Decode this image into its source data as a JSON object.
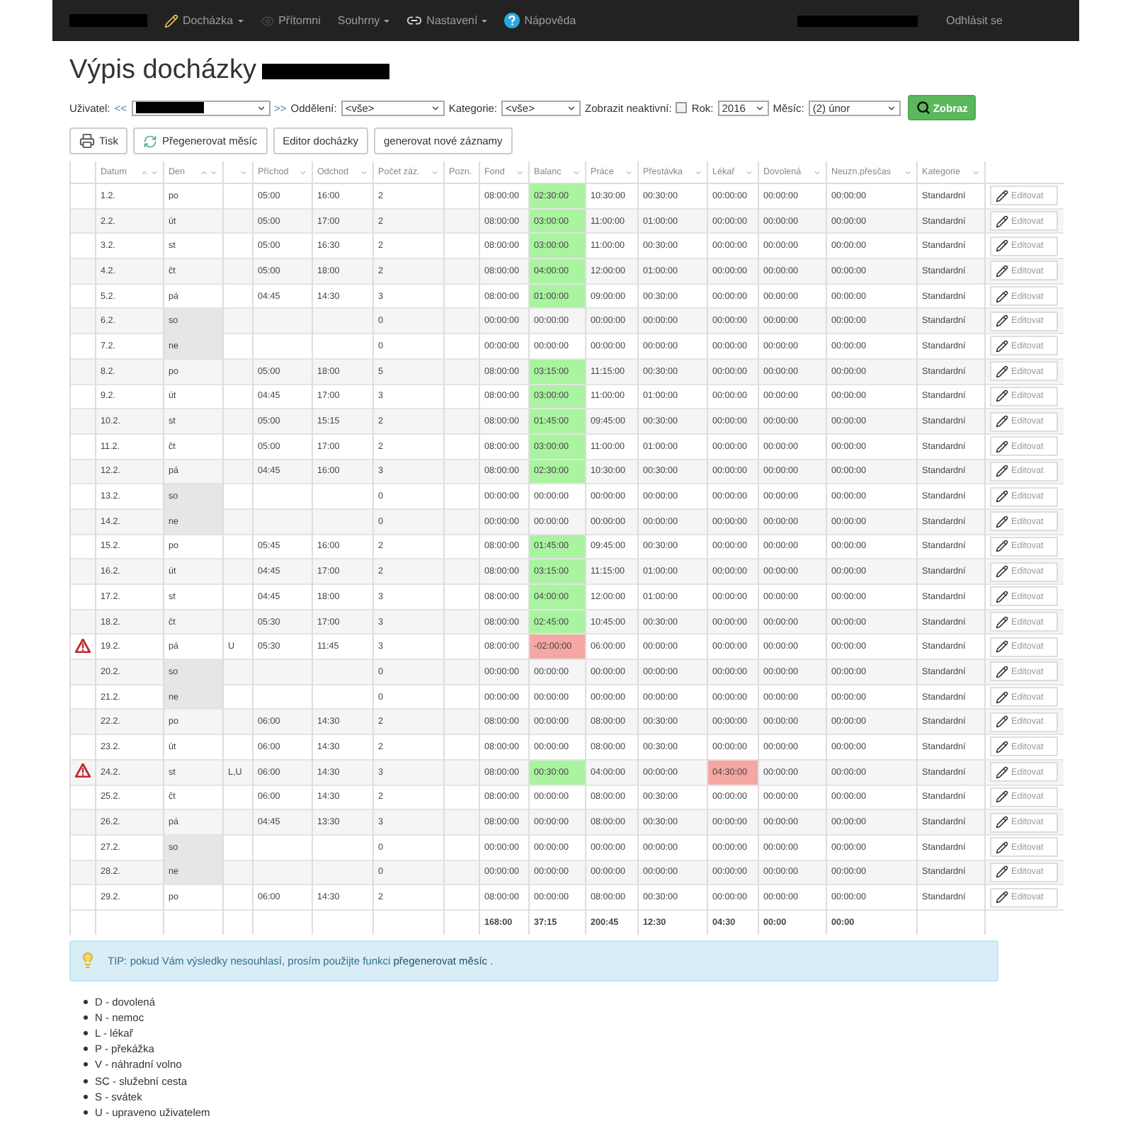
{
  "nav": {
    "items": [
      {
        "label": "Docházka",
        "dropdown": true
      },
      {
        "label": "Přítomni",
        "dropdown": false
      },
      {
        "label": "Souhrny",
        "dropdown": true
      },
      {
        "label": "Nastavení",
        "dropdown": true
      },
      {
        "label": "Nápověda",
        "dropdown": false
      }
    ],
    "logout": "Odhlásit se"
  },
  "title": "Výpis docházky",
  "filters": {
    "user_label": "Uživatel:",
    "prev": "<<",
    "next": ">>",
    "department_label": "Oddělení:",
    "department": "<vše>",
    "category_label": "Kategorie:",
    "category": "<vše>",
    "inactive_label": "Zobrazit neaktivní:",
    "inactive": false,
    "year_label": "Rok:",
    "year": "2016",
    "month_label": "Měsíc:",
    "month": "(2) únor",
    "submit": "Zobraz"
  },
  "actions": [
    {
      "label": "Tisk"
    },
    {
      "label": "Přegenerovat měsíc"
    },
    {
      "label": "Editor docházky"
    },
    {
      "label": "generovat nové záznamy"
    }
  ],
  "table": {
    "columns": [
      {
        "sorted": false,
        "filter": false
      },
      {
        "label": "Datum",
        "sorted": true,
        "filter": true
      },
      {
        "label": "Den",
        "sorted": true,
        "filter": true
      },
      {
        "sorted": false,
        "filter": true
      },
      {
        "label": "Příchod",
        "sorted": false,
        "filter": true
      },
      {
        "label": "Odchod",
        "sorted": false,
        "filter": true
      },
      {
        "label": "Počet záz.",
        "sorted": false,
        "filter": true
      },
      {
        "label": "Pozn.",
        "sorted": false,
        "filter": false
      },
      {
        "label": "Fond",
        "sorted": false,
        "filter": true
      },
      {
        "label": "Balanc",
        "sorted": false,
        "filter": true
      },
      {
        "label": "Práce",
        "sorted": false,
        "filter": true
      },
      {
        "label": "Přestávka",
        "sorted": false,
        "filter": true
      },
      {
        "label": "Lékař",
        "sorted": false,
        "filter": true
      },
      {
        "label": "Dovolená",
        "sorted": false,
        "filter": true
      },
      {
        "label": "Neuzn.přesčas",
        "sorted": false,
        "filter": true
      },
      {
        "label": "Kategorie",
        "sorted": false,
        "filter": true
      },
      {
        "sorted": false,
        "filter": false
      }
    ],
    "rows": [
      {
        "warning": false,
        "date": "1.2.",
        "day": "po",
        "weekend": false,
        "arrival": "05:00",
        "departure": "16:00",
        "records": "2",
        "fond": "08:00:00",
        "balance": "02:30:00",
        "surplus": true,
        "deficit": false,
        "work": "10:30:00",
        "break": "00:30:00",
        "doctor": "00:00:00",
        "doctor_alert": false,
        "vacation": "00:00:00",
        "overtime": "00:00:00",
        "category": "Standardní",
        "edit": "Editovat"
      },
      {
        "warning": false,
        "date": "2.2.",
        "day": "út",
        "weekend": false,
        "arrival": "05:00",
        "departure": "17:00",
        "records": "2",
        "fond": "08:00:00",
        "balance": "03:00:00",
        "surplus": true,
        "deficit": false,
        "work": "11:00:00",
        "break": "01:00:00",
        "doctor": "00:00:00",
        "doctor_alert": false,
        "vacation": "00:00:00",
        "overtime": "00:00:00",
        "category": "Standardní",
        "edit": "Editovat"
      },
      {
        "warning": false,
        "date": "3.2.",
        "day": "st",
        "weekend": false,
        "arrival": "05:00",
        "departure": "16:30",
        "records": "2",
        "fond": "08:00:00",
        "balance": "03:00:00",
        "surplus": true,
        "deficit": false,
        "work": "11:00:00",
        "break": "00:30:00",
        "doctor": "00:00:00",
        "doctor_alert": false,
        "vacation": "00:00:00",
        "overtime": "00:00:00",
        "category": "Standardní",
        "edit": "Editovat"
      },
      {
        "warning": false,
        "date": "4.2.",
        "day": "čt",
        "weekend": false,
        "arrival": "05:00",
        "departure": "18:00",
        "records": "2",
        "fond": "08:00:00",
        "balance": "04:00:00",
        "surplus": true,
        "deficit": false,
        "work": "12:00:00",
        "break": "01:00:00",
        "doctor": "00:00:00",
        "doctor_alert": false,
        "vacation": "00:00:00",
        "overtime": "00:00:00",
        "category": "Standardní",
        "edit": "Editovat"
      },
      {
        "warning": false,
        "date": "5.2.",
        "day": "pá",
        "weekend": false,
        "arrival": "04:45",
        "departure": "14:30",
        "records": "3",
        "fond": "08:00:00",
        "balance": "01:00:00",
        "surplus": true,
        "deficit": false,
        "work": "09:00:00",
        "break": "00:30:00",
        "doctor": "00:00:00",
        "doctor_alert": false,
        "vacation": "00:00:00",
        "overtime": "00:00:00",
        "category": "Standardní",
        "edit": "Editovat"
      },
      {
        "warning": false,
        "date": "6.2.",
        "day": "so",
        "weekend": true,
        "records": "0",
        "fond": "00:00:00",
        "balance": "00:00:00",
        "surplus": false,
        "deficit": false,
        "work": "00:00:00",
        "break": "00:00:00",
        "doctor": "00:00:00",
        "doctor_alert": false,
        "vacation": "00:00:00",
        "overtime": "00:00:00",
        "category": "Standardní",
        "edit": "Editovat"
      },
      {
        "warning": false,
        "date": "7.2.",
        "day": "ne",
        "weekend": true,
        "records": "0",
        "fond": "00:00:00",
        "balance": "00:00:00",
        "surplus": false,
        "deficit": false,
        "work": "00:00:00",
        "break": "00:00:00",
        "doctor": "00:00:00",
        "doctor_alert": false,
        "vacation": "00:00:00",
        "overtime": "00:00:00",
        "category": "Standardní",
        "edit": "Editovat"
      },
      {
        "warning": false,
        "date": "8.2.",
        "day": "po",
        "weekend": false,
        "arrival": "05:00",
        "departure": "18:00",
        "records": "5",
        "fond": "08:00:00",
        "balance": "03:15:00",
        "surplus": true,
        "deficit": false,
        "work": "11:15:00",
        "break": "00:30:00",
        "doctor": "00:00:00",
        "doctor_alert": false,
        "vacation": "00:00:00",
        "overtime": "00:00:00",
        "category": "Standardní",
        "edit": "Editovat"
      },
      {
        "warning": false,
        "date": "9.2.",
        "day": "út",
        "weekend": false,
        "arrival": "04:45",
        "departure": "17:00",
        "records": "3",
        "fond": "08:00:00",
        "balance": "03:00:00",
        "surplus": true,
        "deficit": false,
        "work": "11:00:00",
        "break": "01:00:00",
        "doctor": "00:00:00",
        "doctor_alert": false,
        "vacation": "00:00:00",
        "overtime": "00:00:00",
        "category": "Standardní",
        "edit": "Editovat"
      },
      {
        "warning": false,
        "date": "10.2.",
        "day": "st",
        "weekend": false,
        "arrival": "05:00",
        "departure": "15:15",
        "records": "2",
        "fond": "08:00:00",
        "balance": "01:45:00",
        "surplus": true,
        "deficit": false,
        "work": "09:45:00",
        "break": "00:30:00",
        "doctor": "00:00:00",
        "doctor_alert": false,
        "vacation": "00:00:00",
        "overtime": "00:00:00",
        "category": "Standardní",
        "edit": "Editovat"
      },
      {
        "warning": false,
        "date": "11.2.",
        "day": "čt",
        "weekend": false,
        "arrival": "05:00",
        "departure": "17:00",
        "records": "2",
        "fond": "08:00:00",
        "balance": "03:00:00",
        "surplus": true,
        "deficit": false,
        "work": "11:00:00",
        "break": "01:00:00",
        "doctor": "00:00:00",
        "doctor_alert": false,
        "vacation": "00:00:00",
        "overtime": "00:00:00",
        "category": "Standardní",
        "edit": "Editovat"
      },
      {
        "warning": false,
        "date": "12.2.",
        "day": "pá",
        "weekend": false,
        "arrival": "04:45",
        "departure": "16:00",
        "records": "3",
        "fond": "08:00:00",
        "balance": "02:30:00",
        "surplus": true,
        "deficit": false,
        "work": "10:30:00",
        "break": "00:30:00",
        "doctor": "00:00:00",
        "doctor_alert": false,
        "vacation": "00:00:00",
        "overtime": "00:00:00",
        "category": "Standardní",
        "edit": "Editovat"
      },
      {
        "warning": false,
        "date": "13.2.",
        "day": "so",
        "weekend": true,
        "records": "0",
        "fond": "00:00:00",
        "balance": "00:00:00",
        "surplus": false,
        "deficit": false,
        "work": "00:00:00",
        "break": "00:00:00",
        "doctor": "00:00:00",
        "doctor_alert": false,
        "vacation": "00:00:00",
        "overtime": "00:00:00",
        "category": "Standardní",
        "edit": "Editovat"
      },
      {
        "warning": false,
        "date": "14.2.",
        "day": "ne",
        "weekend": true,
        "records": "0",
        "fond": "00:00:00",
        "balance": "00:00:00",
        "surplus": false,
        "deficit": false,
        "work": "00:00:00",
        "break": "00:00:00",
        "doctor": "00:00:00",
        "doctor_alert": false,
        "vacation": "00:00:00",
        "overtime": "00:00:00",
        "category": "Standardní",
        "edit": "Editovat"
      },
      {
        "warning": false,
        "date": "15.2.",
        "day": "po",
        "weekend": false,
        "arrival": "05:45",
        "departure": "16:00",
        "records": "2",
        "fond": "08:00:00",
        "balance": "01:45:00",
        "surplus": true,
        "deficit": false,
        "work": "09:45:00",
        "break": "00:30:00",
        "doctor": "00:00:00",
        "doctor_alert": false,
        "vacation": "00:00:00",
        "overtime": "00:00:00",
        "category": "Standardní",
        "edit": "Editovat"
      },
      {
        "warning": false,
        "date": "16.2.",
        "day": "út",
        "weekend": false,
        "arrival": "04:45",
        "departure": "17:00",
        "records": "2",
        "fond": "08:00:00",
        "balance": "03:15:00",
        "surplus": true,
        "deficit": false,
        "work": "11:15:00",
        "break": "01:00:00",
        "doctor": "00:00:00",
        "doctor_alert": false,
        "vacation": "00:00:00",
        "overtime": "00:00:00",
        "category": "Standardní",
        "edit": "Editovat"
      },
      {
        "warning": false,
        "date": "17.2.",
        "day": "st",
        "weekend": false,
        "arrival": "04:45",
        "departure": "18:00",
        "records": "3",
        "fond": "08:00:00",
        "balance": "04:00:00",
        "surplus": true,
        "deficit": false,
        "work": "12:00:00",
        "break": "01:00:00",
        "doctor": "00:00:00",
        "doctor_alert": false,
        "vacation": "00:00:00",
        "overtime": "00:00:00",
        "category": "Standardní",
        "edit": "Editovat"
      },
      {
        "warning": false,
        "date": "18.2.",
        "day": "čt",
        "weekend": false,
        "arrival": "05:30",
        "departure": "17:00",
        "records": "3",
        "fond": "08:00:00",
        "balance": "02:45:00",
        "surplus": true,
        "deficit": false,
        "work": "10:45:00",
        "break": "00:30:00",
        "doctor": "00:00:00",
        "doctor_alert": false,
        "vacation": "00:00:00",
        "overtime": "00:00:00",
        "category": "Standardní",
        "edit": "Editovat"
      },
      {
        "warning": true,
        "date": "19.2.",
        "day": "pá",
        "weekend": false,
        "code": "U",
        "arrival": "05:30",
        "departure": "11:45",
        "records": "3",
        "fond": "08:00:00",
        "balance": "-02:00:00",
        "surplus": false,
        "deficit": true,
        "work": "06:00:00",
        "break": "00:00:00",
        "doctor": "00:00:00",
        "doctor_alert": false,
        "vacation": "00:00:00",
        "overtime": "00:00:00",
        "category": "Standardní",
        "edit": "Editovat"
      },
      {
        "warning": false,
        "date": "20.2.",
        "day": "so",
        "weekend": true,
        "records": "0",
        "fond": "00:00:00",
        "balance": "00:00:00",
        "surplus": false,
        "deficit": false,
        "work": "00:00:00",
        "break": "00:00:00",
        "doctor": "00:00:00",
        "doctor_alert": false,
        "vacation": "00:00:00",
        "overtime": "00:00:00",
        "category": "Standardní",
        "edit": "Editovat"
      },
      {
        "warning": false,
        "date": "21.2.",
        "day": "ne",
        "weekend": true,
        "records": "0",
        "fond": "00:00:00",
        "balance": "00:00:00",
        "surplus": false,
        "deficit": false,
        "work": "00:00:00",
        "break": "00:00:00",
        "doctor": "00:00:00",
        "doctor_alert": false,
        "vacation": "00:00:00",
        "overtime": "00:00:00",
        "category": "Standardní",
        "edit": "Editovat"
      },
      {
        "warning": false,
        "date": "22.2.",
        "day": "po",
        "weekend": false,
        "arrival": "06:00",
        "departure": "14:30",
        "records": "2",
        "fond": "08:00:00",
        "balance": "00:00:00",
        "surplus": false,
        "deficit": false,
        "work": "08:00:00",
        "break": "00:30:00",
        "doctor": "00:00:00",
        "doctor_alert": false,
        "vacation": "00:00:00",
        "overtime": "00:00:00",
        "category": "Standardní",
        "edit": "Editovat"
      },
      {
        "warning": false,
        "date": "23.2.",
        "day": "út",
        "weekend": false,
        "arrival": "06:00",
        "departure": "14:30",
        "records": "2",
        "fond": "08:00:00",
        "balance": "00:00:00",
        "surplus": false,
        "deficit": false,
        "work": "08:00:00",
        "break": "00:30:00",
        "doctor": "00:00:00",
        "doctor_alert": false,
        "vacation": "00:00:00",
        "overtime": "00:00:00",
        "category": "Standardní",
        "edit": "Editovat"
      },
      {
        "warning": true,
        "date": "24.2.",
        "day": "st",
        "weekend": false,
        "code": "L,U",
        "arrival": "06:00",
        "departure": "14:30",
        "records": "3",
        "fond": "08:00:00",
        "balance": "00:30:00",
        "surplus": true,
        "deficit": false,
        "work": "04:00:00",
        "break": "00:00:00",
        "doctor": "04:30:00",
        "doctor_alert": true,
        "vacation": "00:00:00",
        "overtime": "00:00:00",
        "category": "Standardní",
        "edit": "Editovat"
      },
      {
        "warning": false,
        "date": "25.2.",
        "day": "čt",
        "weekend": false,
        "arrival": "06:00",
        "departure": "14:30",
        "records": "2",
        "fond": "08:00:00",
        "balance": "00:00:00",
        "surplus": false,
        "deficit": false,
        "work": "08:00:00",
        "break": "00:30:00",
        "doctor": "00:00:00",
        "doctor_alert": false,
        "vacation": "00:00:00",
        "overtime": "00:00:00",
        "category": "Standardní",
        "edit": "Editovat"
      },
      {
        "warning": false,
        "date": "26.2.",
        "day": "pá",
        "weekend": false,
        "arrival": "04:45",
        "departure": "13:30",
        "records": "3",
        "fond": "08:00:00",
        "balance": "00:00:00",
        "surplus": false,
        "deficit": false,
        "work": "08:00:00",
        "break": "00:30:00",
        "doctor": "00:00:00",
        "doctor_alert": false,
        "vacation": "00:00:00",
        "overtime": "00:00:00",
        "category": "Standardní",
        "edit": "Editovat"
      },
      {
        "warning": false,
        "date": "27.2.",
        "day": "so",
        "weekend": true,
        "records": "0",
        "fond": "00:00:00",
        "balance": "00:00:00",
        "surplus": false,
        "deficit": false,
        "work": "00:00:00",
        "break": "00:00:00",
        "doctor": "00:00:00",
        "doctor_alert": false,
        "vacation": "00:00:00",
        "overtime": "00:00:00",
        "category": "Standardní",
        "edit": "Editovat"
      },
      {
        "warning": false,
        "date": "28.2.",
        "day": "ne",
        "weekend": true,
        "records": "0",
        "fond": "00:00:00",
        "balance": "00:00:00",
        "surplus": false,
        "deficit": false,
        "work": "00:00:00",
        "break": "00:00:00",
        "doctor": "00:00:00",
        "doctor_alert": false,
        "vacation": "00:00:00",
        "overtime": "00:00:00",
        "category": "Standardní",
        "edit": "Editovat"
      },
      {
        "warning": false,
        "date": "29.2.",
        "day": "po",
        "weekend": false,
        "arrival": "06:00",
        "departure": "14:30",
        "records": "2",
        "fond": "08:00:00",
        "balance": "00:00:00",
        "surplus": false,
        "deficit": false,
        "work": "08:00:00",
        "break": "00:30:00",
        "doctor": "00:00:00",
        "doctor_alert": false,
        "vacation": "00:00:00",
        "overtime": "00:00:00",
        "category": "Standardní",
        "edit": "Editovat"
      }
    ],
    "totals": {
      "fond": "168:00",
      "balance": "37:15",
      "work": "200:45",
      "break": "12:30",
      "doctor": "04:30",
      "vacation": "00:00",
      "overtime": "00:00"
    }
  },
  "tip": {
    "before": "TIP: pokud Vám výsledky nesouhlasí, prosím použijte funkci ",
    "link": "přegenerovat měsíc",
    "after": " ."
  },
  "legend": [
    "D - dovolená",
    "N - nemoc",
    "L - lékař",
    "P - překážka",
    "V - náhradní volno",
    "SC - služební cesta",
    "S - svátek",
    "U - upraveno uživatelem"
  ]
}
